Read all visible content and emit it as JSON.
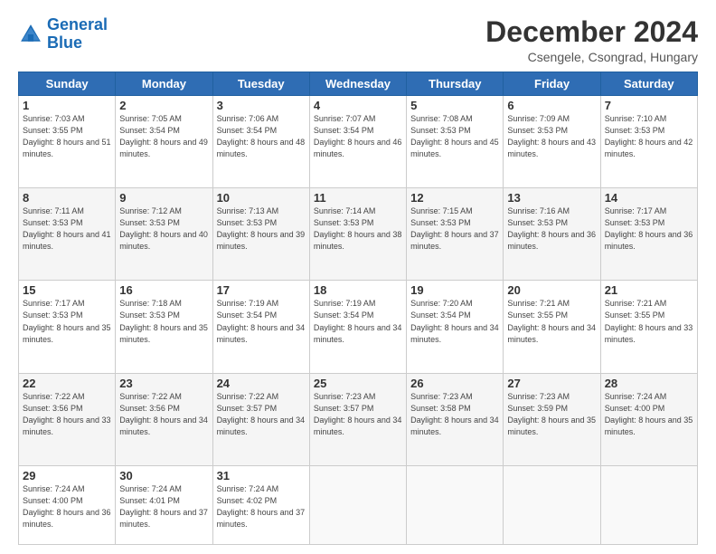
{
  "header": {
    "logo_line1": "General",
    "logo_line2": "Blue",
    "month": "December 2024",
    "location": "Csengele, Csongrad, Hungary"
  },
  "days_of_week": [
    "Sunday",
    "Monday",
    "Tuesday",
    "Wednesday",
    "Thursday",
    "Friday",
    "Saturday"
  ],
  "weeks": [
    [
      {
        "day": 1,
        "sunrise": "7:03 AM",
        "sunset": "3:55 PM",
        "daylight": "8 hours and 51 minutes."
      },
      {
        "day": 2,
        "sunrise": "7:05 AM",
        "sunset": "3:54 PM",
        "daylight": "8 hours and 49 minutes."
      },
      {
        "day": 3,
        "sunrise": "7:06 AM",
        "sunset": "3:54 PM",
        "daylight": "8 hours and 48 minutes."
      },
      {
        "day": 4,
        "sunrise": "7:07 AM",
        "sunset": "3:54 PM",
        "daylight": "8 hours and 46 minutes."
      },
      {
        "day": 5,
        "sunrise": "7:08 AM",
        "sunset": "3:53 PM",
        "daylight": "8 hours and 45 minutes."
      },
      {
        "day": 6,
        "sunrise": "7:09 AM",
        "sunset": "3:53 PM",
        "daylight": "8 hours and 43 minutes."
      },
      {
        "day": 7,
        "sunrise": "7:10 AM",
        "sunset": "3:53 PM",
        "daylight": "8 hours and 42 minutes."
      }
    ],
    [
      {
        "day": 8,
        "sunrise": "7:11 AM",
        "sunset": "3:53 PM",
        "daylight": "8 hours and 41 minutes."
      },
      {
        "day": 9,
        "sunrise": "7:12 AM",
        "sunset": "3:53 PM",
        "daylight": "8 hours and 40 minutes."
      },
      {
        "day": 10,
        "sunrise": "7:13 AM",
        "sunset": "3:53 PM",
        "daylight": "8 hours and 39 minutes."
      },
      {
        "day": 11,
        "sunrise": "7:14 AM",
        "sunset": "3:53 PM",
        "daylight": "8 hours and 38 minutes."
      },
      {
        "day": 12,
        "sunrise": "7:15 AM",
        "sunset": "3:53 PM",
        "daylight": "8 hours and 37 minutes."
      },
      {
        "day": 13,
        "sunrise": "7:16 AM",
        "sunset": "3:53 PM",
        "daylight": "8 hours and 36 minutes."
      },
      {
        "day": 14,
        "sunrise": "7:17 AM",
        "sunset": "3:53 PM",
        "daylight": "8 hours and 36 minutes."
      }
    ],
    [
      {
        "day": 15,
        "sunrise": "7:17 AM",
        "sunset": "3:53 PM",
        "daylight": "8 hours and 35 minutes."
      },
      {
        "day": 16,
        "sunrise": "7:18 AM",
        "sunset": "3:53 PM",
        "daylight": "8 hours and 35 minutes."
      },
      {
        "day": 17,
        "sunrise": "7:19 AM",
        "sunset": "3:54 PM",
        "daylight": "8 hours and 34 minutes."
      },
      {
        "day": 18,
        "sunrise": "7:19 AM",
        "sunset": "3:54 PM",
        "daylight": "8 hours and 34 minutes."
      },
      {
        "day": 19,
        "sunrise": "7:20 AM",
        "sunset": "3:54 PM",
        "daylight": "8 hours and 34 minutes."
      },
      {
        "day": 20,
        "sunrise": "7:21 AM",
        "sunset": "3:55 PM",
        "daylight": "8 hours and 34 minutes."
      },
      {
        "day": 21,
        "sunrise": "7:21 AM",
        "sunset": "3:55 PM",
        "daylight": "8 hours and 33 minutes."
      }
    ],
    [
      {
        "day": 22,
        "sunrise": "7:22 AM",
        "sunset": "3:56 PM",
        "daylight": "8 hours and 33 minutes."
      },
      {
        "day": 23,
        "sunrise": "7:22 AM",
        "sunset": "3:56 PM",
        "daylight": "8 hours and 34 minutes."
      },
      {
        "day": 24,
        "sunrise": "7:22 AM",
        "sunset": "3:57 PM",
        "daylight": "8 hours and 34 minutes."
      },
      {
        "day": 25,
        "sunrise": "7:23 AM",
        "sunset": "3:57 PM",
        "daylight": "8 hours and 34 minutes."
      },
      {
        "day": 26,
        "sunrise": "7:23 AM",
        "sunset": "3:58 PM",
        "daylight": "8 hours and 34 minutes."
      },
      {
        "day": 27,
        "sunrise": "7:23 AM",
        "sunset": "3:59 PM",
        "daylight": "8 hours and 35 minutes."
      },
      {
        "day": 28,
        "sunrise": "7:24 AM",
        "sunset": "4:00 PM",
        "daylight": "8 hours and 35 minutes."
      }
    ],
    [
      {
        "day": 29,
        "sunrise": "7:24 AM",
        "sunset": "4:00 PM",
        "daylight": "8 hours and 36 minutes."
      },
      {
        "day": 30,
        "sunrise": "7:24 AM",
        "sunset": "4:01 PM",
        "daylight": "8 hours and 37 minutes."
      },
      {
        "day": 31,
        "sunrise": "7:24 AM",
        "sunset": "4:02 PM",
        "daylight": "8 hours and 37 minutes."
      },
      null,
      null,
      null,
      null
    ]
  ]
}
